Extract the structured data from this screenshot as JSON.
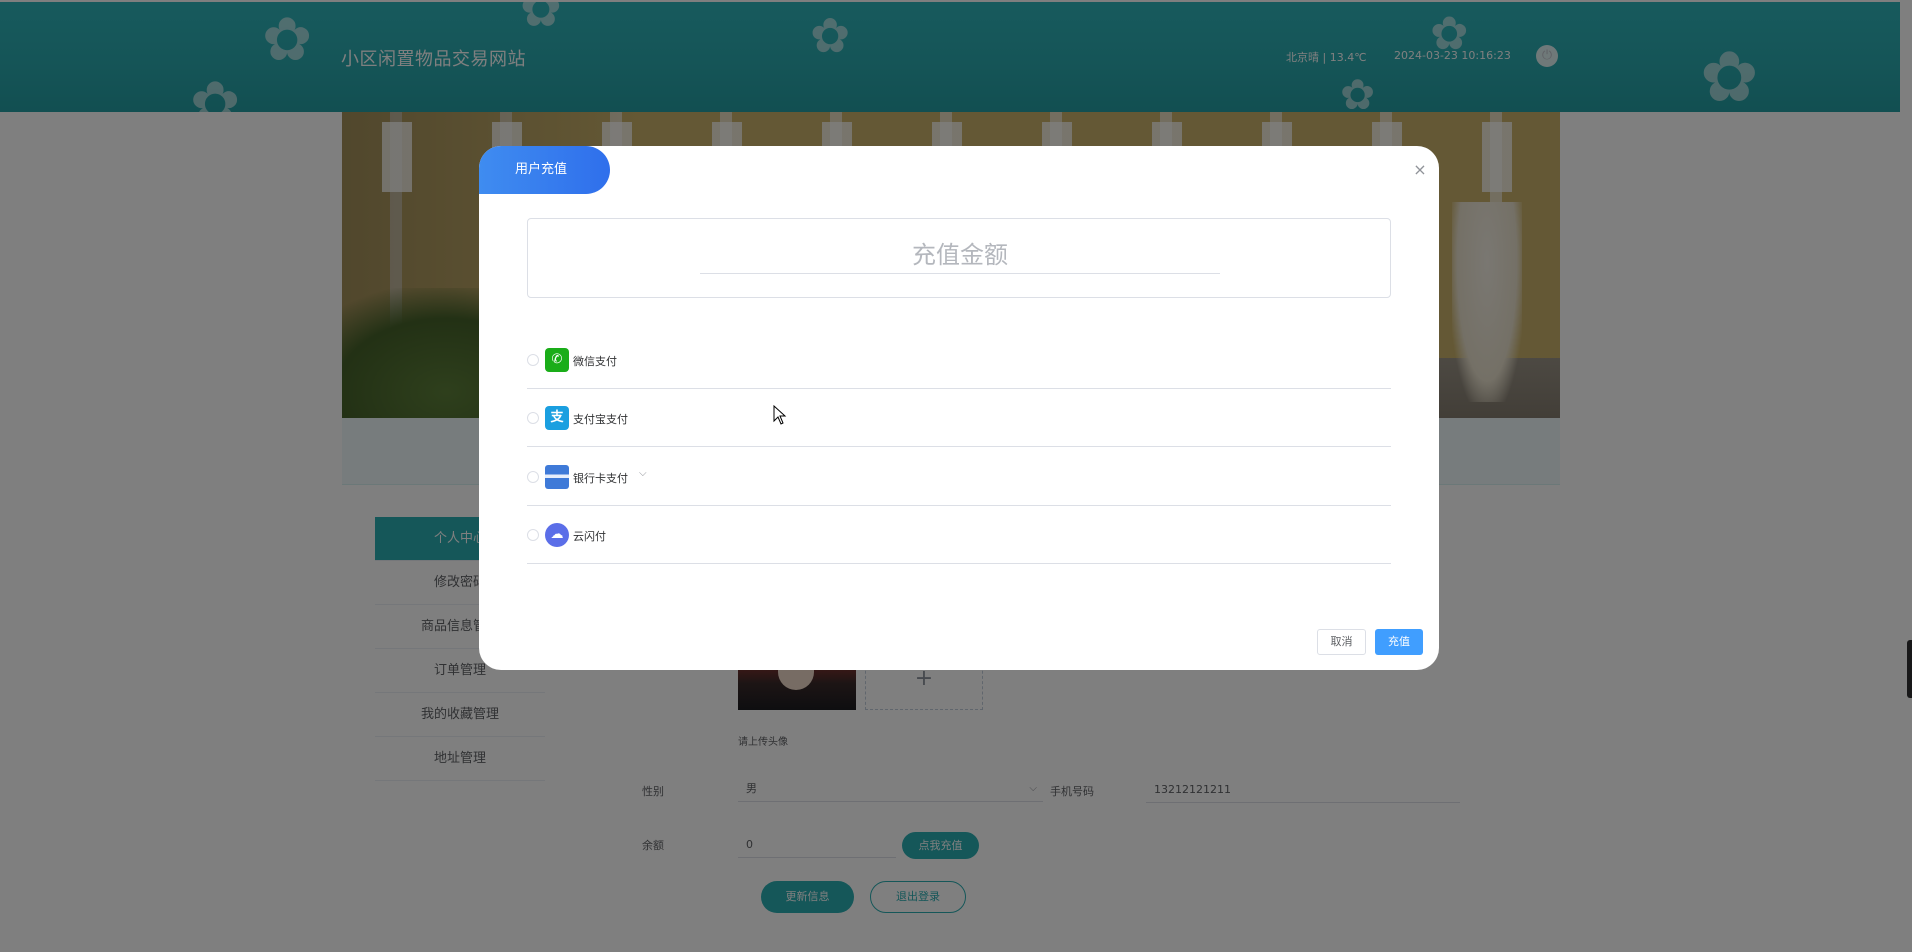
{
  "header": {
    "site_title": "小区闲置物品交易网站",
    "weather": "北京晴 | 13.4℃",
    "datetime": "2024-03-23   10:16:23",
    "power_icon": "power-icon"
  },
  "side_menu": {
    "items": [
      {
        "label": "个人中心",
        "active": true
      },
      {
        "label": "修改密码",
        "active": false
      },
      {
        "label": "商品信息管理",
        "active": false
      },
      {
        "label": "订单管理",
        "active": false
      },
      {
        "label": "我的收藏管理",
        "active": false
      },
      {
        "label": "地址管理",
        "active": false
      }
    ]
  },
  "profile_form": {
    "upload_tip": "请上传头像",
    "gender_label": "性别",
    "gender_value": "男",
    "phone_label": "手机号码",
    "phone_value": "13212121211",
    "balance_label": "余额",
    "balance_value": "0",
    "recharge_link": "点我充值",
    "update_button": "更新信息",
    "logout_button": "退出登录"
  },
  "dialog": {
    "title": "用户充值",
    "close_icon": "close-icon",
    "amount_placeholder": "充值金额",
    "payment_methods": [
      {
        "label": "微信支付",
        "icon": "wechat-icon",
        "color": "#1aad19"
      },
      {
        "label": "支付宝支付",
        "icon": "alipay-icon",
        "color": "#1a9fe0"
      },
      {
        "label": "银行卡支付",
        "icon": "bank-card-icon",
        "color": "#3f7ad8"
      },
      {
        "label": "云闪付",
        "icon": "unionpay-cloud-icon",
        "color": "#5b6ee8"
      }
    ],
    "cancel_button": "取消",
    "confirm_button": "充值"
  },
  "colors": {
    "header_teal": "#2aa9ae",
    "accent_teal": "#2aaeb2",
    "primary_blue": "#409eff",
    "title_blue": "#2f6fec"
  }
}
